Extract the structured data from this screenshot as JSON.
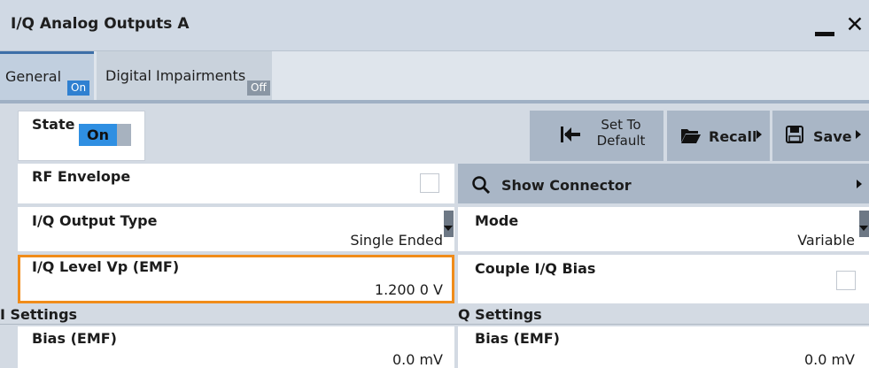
{
  "window": {
    "title": "I/Q Analog Outputs A"
  },
  "tabs": [
    {
      "label": "General",
      "badge": "On"
    },
    {
      "label": "Digital Impairments",
      "badge": "Off"
    }
  ],
  "state": {
    "label": "State",
    "value": "On"
  },
  "toolbar": {
    "set_default_line1": "Set To",
    "set_default_line2": "Default",
    "recall_label": "Recall",
    "save_label": "Save"
  },
  "rf_envelope": {
    "label": "RF Envelope",
    "checked": false
  },
  "show_connector": {
    "label": "Show Connector"
  },
  "iq_output_type": {
    "label": "I/Q Output Type",
    "value": "Single Ended"
  },
  "mode": {
    "label": "Mode",
    "value": "Variable"
  },
  "iq_level": {
    "label": "I/Q Level Vp (EMF)",
    "value": "1.200 0 V"
  },
  "couple_iq_bias": {
    "label": "Couple I/Q Bias",
    "checked": false
  },
  "i_settings": {
    "header": "I Settings",
    "bias_label": "Bias (EMF)",
    "bias_value": "0.0 mV"
  },
  "q_settings": {
    "header": "Q Settings",
    "bias_label": "Bias (EMF)",
    "bias_value": "0.0 mV"
  },
  "colors": {
    "accent": "#2f8fe2",
    "focus": "#f08c1a",
    "button": "#a9b6c6"
  },
  "icons": [
    "minimize-icon",
    "close-icon",
    "set-default-icon",
    "folder-open-icon",
    "floppy-disk-icon",
    "magnifier-icon",
    "dropdown-arrow-icon"
  ]
}
